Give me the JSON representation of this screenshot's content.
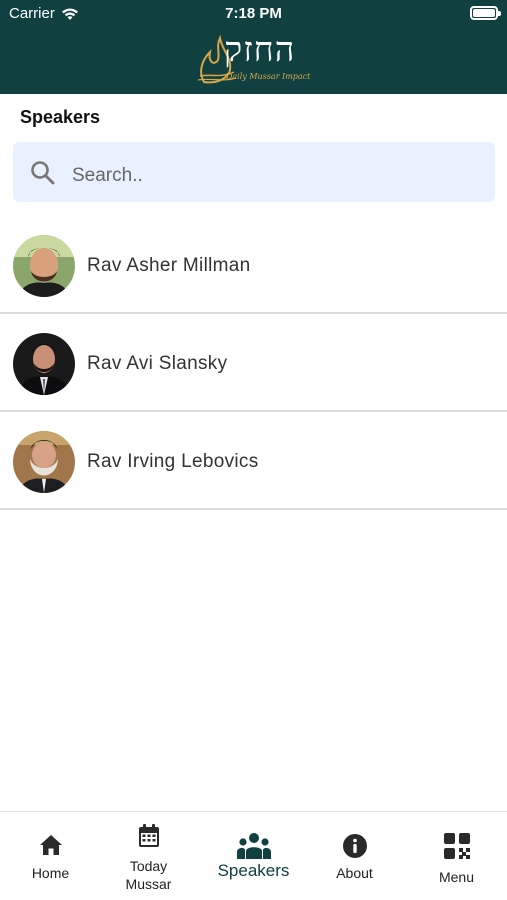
{
  "status_bar": {
    "carrier": "Carrier",
    "time": "7:18 PM"
  },
  "header": {
    "logo_hebrew": "החזק",
    "logo_subtitle": "Daily Mussar Impact"
  },
  "page": {
    "title": "Speakers"
  },
  "search": {
    "placeholder": "Search.."
  },
  "speakers": [
    {
      "name": "Rav Asher Millman"
    },
    {
      "name": "Rav Avi Slansky"
    },
    {
      "name": "Rav Irving Lebovics"
    }
  ],
  "tab_bar": {
    "items": [
      {
        "label": "Home",
        "icon": "home-icon"
      },
      {
        "label": "Today\nMussar",
        "icon": "calendar-icon"
      },
      {
        "label": "Speakers",
        "icon": "speakers-icon",
        "active": true
      },
      {
        "label": "About",
        "icon": "info-icon"
      },
      {
        "label": "Menu",
        "icon": "qr-menu-icon"
      }
    ]
  },
  "colors": {
    "header_bg": "#104040",
    "accent": "#104040",
    "search_bg": "#e9f1fe",
    "logo_gold": "#d9a64a"
  }
}
